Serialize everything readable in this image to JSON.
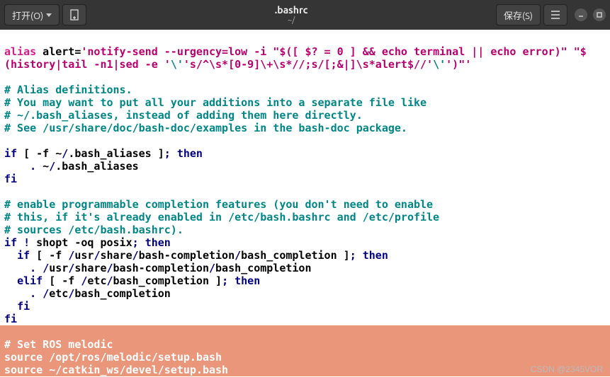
{
  "titlebar": {
    "open_label": "打开(O)",
    "title": ".bashrc",
    "subtitle": "~/",
    "save_label": "保存(S)"
  },
  "code": {
    "l1a": "alias",
    "l1b": " alert=",
    "l1c": "'notify-send --urgency=low -i \"$([ $? = 0 ] && echo terminal || echo error)\" \"$",
    "l2a": "(history|tail -n1|sed -e '",
    "l2b": "\\'",
    "l2c": "'s/^\\s*[0-9]\\+\\s*//;s/[;&|]\\s*alert$//'",
    "l2d": "\\'",
    "l2e": "')\"'",
    "c1": "# Alias definitions.",
    "c2": "# You may want to put all your additions into a separate file like",
    "c3": "# ~/.bash_aliases, instead of adding them here directly.",
    "c4": "# See /usr/share/doc/bash-doc/examples in the bash-doc package.",
    "if": "if",
    "fi": "fi",
    "then": "then",
    "elif": "elif",
    "semi": ";",
    "dot": ".",
    "slash": "/",
    "bang": "!",
    "ba_test": " [ -f ~",
    "ba_test2": ".bash_aliases ]",
    "ba_src1": "    ",
    "ba_src2": " ~",
    "ba_src3": ".bash_aliases",
    "c5": "# enable programmable completion features (you don't need to enable",
    "c6": "# this, if it's already enabled in /etc/bash.bashrc and /etc/profile",
    "c7": "# sources /etc/bash.bashrc).",
    "shopt": " shopt ",
    "shopt_arg": "-oq posix",
    "pc1a": "  ",
    "pc1b": " [ -f ",
    "pc1c": "usr",
    "pc1d": "share",
    "pc1e": "bash-completion",
    "pc1f": "bash_completion ]",
    "pc2a": "    ",
    "pc2b": " ",
    "pc2c": "usr",
    "pc2d": "share",
    "pc2e": "bash-completion",
    "pc2f": "bash_completion",
    "el1a": "  ",
    "el1b": " [ -f ",
    "el1c": "etc",
    "el1d": "bash_completion ]",
    "el2a": "    ",
    "el2b": " ",
    "el2c": "etc",
    "el2d": "bash_completion",
    "fi_in": "  ",
    "ros_c": "# Set ROS melodic",
    "src": "source",
    "r1a": " ",
    "r1b": "opt",
    "r1c": "ros",
    "r1d": "melodic",
    "r1e": "setup.bash",
    "r2a": " ~",
    "r2b": "catkin_ws",
    "r2c": "devel",
    "r2d": "setup.bash"
  },
  "watermark": "CSDN @2345VOR"
}
